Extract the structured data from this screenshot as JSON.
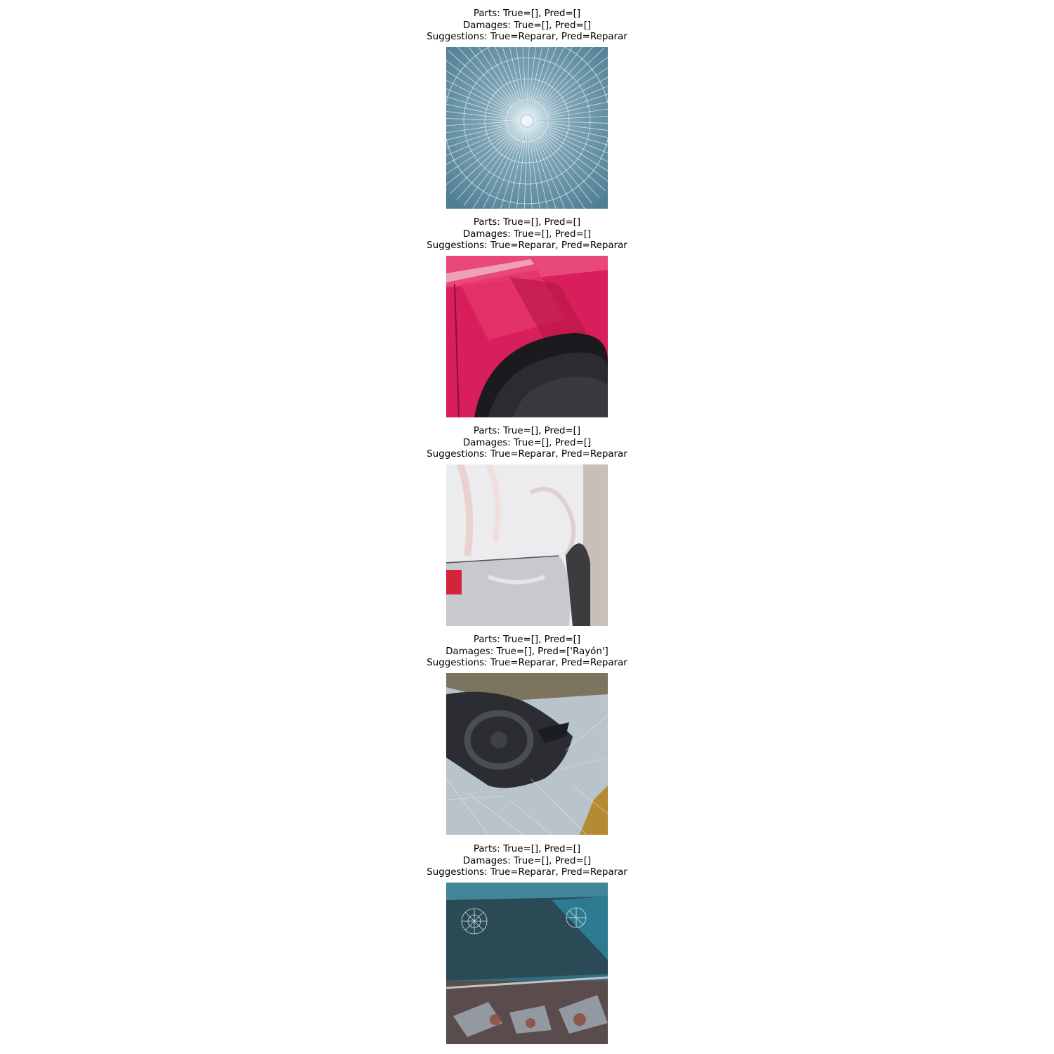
{
  "samples": [
    {
      "parts": "Parts: True=[], Pred=[]",
      "damages": "Damages: True=[], Pred=[]",
      "suggestions": "Suggestions: True=Reparar, Pred=Reparar",
      "image": "shattered-glass-photo"
    },
    {
      "parts": "Parts: True=[], Pred=[]",
      "damages": "Damages: True=[], Pred=[]",
      "suggestions": "Suggestions: True=Reparar, Pred=Reparar",
      "image": "dented-red-fender-photo"
    },
    {
      "parts": "Parts: True=[], Pred=[]",
      "damages": "Damages: True=[], Pred=[]",
      "suggestions": "Suggestions: True=Reparar, Pred=Reparar",
      "image": "dented-white-car-rear-photo"
    },
    {
      "parts": "Parts: True=[], Pred=[]",
      "damages": "Damages: True=[], Pred=['Rayón']",
      "suggestions": "Suggestions: True=Reparar, Pred=Reparar",
      "image": "broken-window-steering-wheel-photo"
    },
    {
      "parts": "Parts: True=[], Pred=[]",
      "damages": "Damages: True=[], Pred=[]",
      "suggestions": "Suggestions: True=Reparar, Pred=Reparar",
      "image": "wrecked-car-windshield-photo"
    }
  ]
}
